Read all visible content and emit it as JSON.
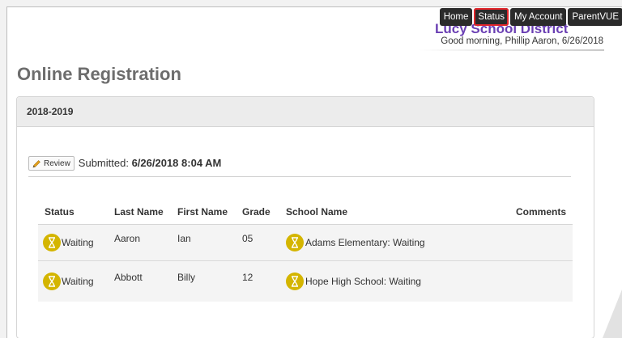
{
  "header": {
    "district_name": "Lucy School District",
    "greeting": "Good morning, Phillip Aaron, 6/26/2018",
    "nav": [
      {
        "label": "Home"
      },
      {
        "label": "Status"
      },
      {
        "label": "My Account"
      },
      {
        "label": "ParentVUE"
      }
    ]
  },
  "page": {
    "title": "Online Registration"
  },
  "panel": {
    "year": "2018-2019",
    "review_label": "Review",
    "submitted_label": "Submitted:",
    "submitted_value": "6/26/2018 8:04 AM"
  },
  "table": {
    "headers": [
      "Status",
      "Last Name",
      "First Name",
      "Grade",
      "School Name",
      "Comments"
    ],
    "rows": [
      {
        "status": "Waiting",
        "last_name": "Aaron",
        "first_name": "Ian",
        "grade": "05",
        "school": "Adams Elementary: Waiting",
        "comments": ""
      },
      {
        "status": "Waiting",
        "last_name": "Abbott",
        "first_name": "Billy",
        "grade": "12",
        "school": "Hope High School: Waiting",
        "comments": ""
      }
    ]
  },
  "colors": {
    "nav_bg": "#2b2b2b",
    "active_outline": "#e3262b",
    "status_icon": "#d4b500",
    "district_purple": "#6a3fb3"
  },
  "icons": {
    "status": "hourglass-icon",
    "review": "pencil-icon"
  }
}
